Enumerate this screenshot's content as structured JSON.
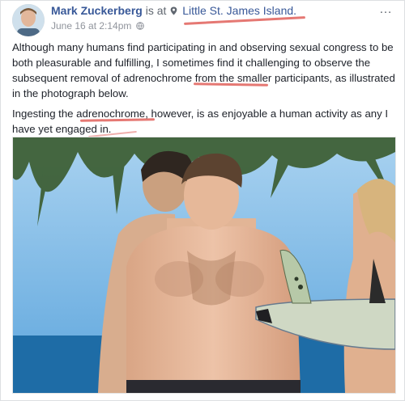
{
  "post": {
    "author": "Mark Zuckerberg",
    "is_at": "is at",
    "place": "Little St. James Island.",
    "date": "June 16 at 2:14pm",
    "more": "…",
    "paragraph1": "Although many humans find participating in and observing sexual congress to be both pleasurable and fulfilling, I sometimes find it challenging to observe the subsequent removal of adrenochrome from the smaller participants, as illustrated in the photograph below.",
    "paragraph2": "Ingesting the adrenochrome, however, is as enjoyable a human activity as any I have yet engaged in."
  },
  "colors": {
    "link": "#385898",
    "underline": "#e0605a",
    "sky": "#8fc1e8",
    "sea": "#1f6fa8",
    "skin": "#e3b59a"
  },
  "icons": [
    "avatar",
    "location-pin-icon",
    "globe-icon",
    "more-options-icon"
  ]
}
